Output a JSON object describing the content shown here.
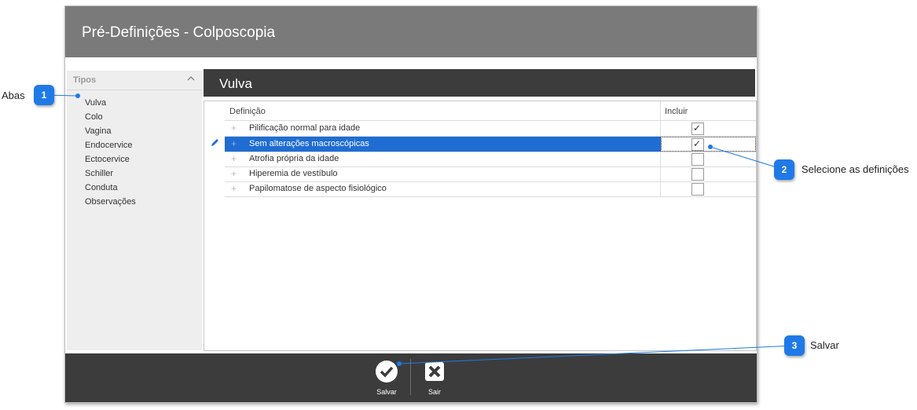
{
  "window": {
    "title": "Pré-Definições - Colposcopia"
  },
  "sidebar": {
    "header": "Tipos",
    "items": [
      "Vulva",
      "Colo",
      "Vagina",
      "Endocervice",
      "Ectocervice",
      "Schiller",
      "Conduta",
      "Observações"
    ]
  },
  "panel": {
    "title": "Vulva"
  },
  "grid": {
    "columns": [
      "Definição",
      "Incluir"
    ],
    "rows": [
      {
        "definicao": "Pilificação normal para idade",
        "incluir": true
      },
      {
        "definicao": "Sem alterações macroscópicas",
        "incluir": true,
        "selected": true
      },
      {
        "definicao": "Atrofia própria da idade",
        "incluir": false
      },
      {
        "definicao": "Hiperemia de vestíbulo",
        "incluir": false
      },
      {
        "definicao": "Papilomatose de aspecto fisiológico",
        "incluir": false
      }
    ]
  },
  "footer": {
    "save_label": "Salvar",
    "exit_label": "Sair"
  },
  "callouts": [
    {
      "number": "1",
      "label": "Abas"
    },
    {
      "number": "2",
      "label": "Selecione as definições"
    },
    {
      "number": "3",
      "label": "Salvar"
    }
  ],
  "check_mark": "✓",
  "plus_mark": "+",
  "colors": {
    "accent": "#1f7ae8",
    "selection": "#1f6dd3",
    "dark_bar": "#3c3c3c",
    "title_bar": "#7a7a7a"
  },
  "icons": [
    "chevron-up-icon",
    "pencil-icon",
    "checkmark-circle-icon",
    "close-x-icon"
  ]
}
